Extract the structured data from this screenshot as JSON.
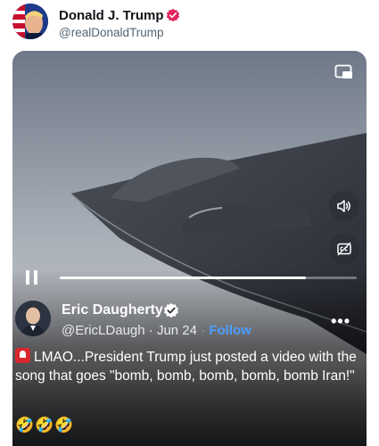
{
  "author": {
    "name": "Donald J. Trump",
    "handle": "@realDonaldTrump",
    "verified_color": "#f0424f"
  },
  "video": {
    "progress": 0.83,
    "state": "playing",
    "controls": [
      "pip-icon",
      "volume-icon",
      "captions-icon",
      "pause-icon"
    ]
  },
  "quote": {
    "name": "Eric Daugherty",
    "handle": "@EricLDaugh",
    "separator": "·",
    "date": "Jun 24",
    "separator2": "·",
    "follow_label": "Follow",
    "more_label": "•••",
    "text": "LMAO...President Trump just posted a video with the song that goes \"bomb, bomb, bomb, bomb, bomb Iran!\"",
    "emoji": "🤣🤣🤣",
    "verified_color": "#ffffff"
  },
  "colors": {
    "accent": "#4a9eff",
    "sky_top": "#7f8896",
    "sky_bottom": "#c2c5ca"
  }
}
